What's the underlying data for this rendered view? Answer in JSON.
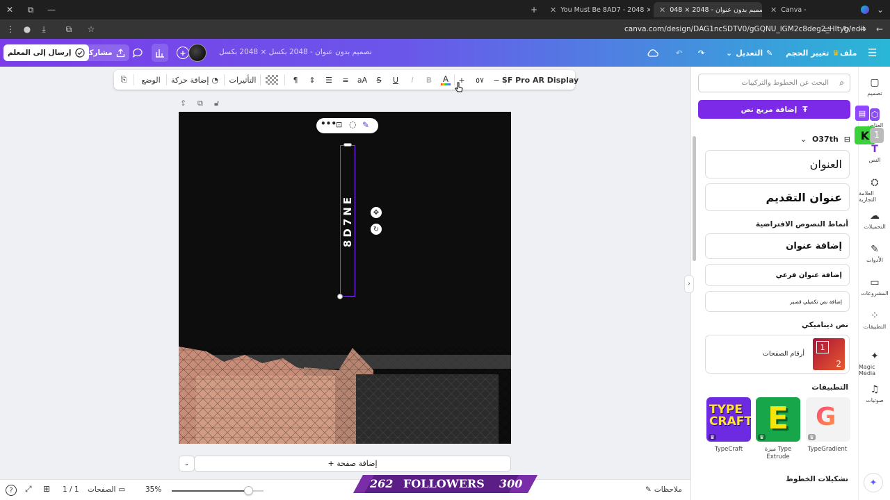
{
  "browser": {
    "tabs": [
      {
        "title": "You Must Be 8AD7 - 2048 × 20",
        "active": false
      },
      {
        "title": "تصميم بدون عنوان - 2048 × 048",
        "active": true
      },
      {
        "title": "Canva -",
        "active": false
      }
    ],
    "url": "canva.com/design/DAG1ncSDTV0/gGQNU_lGM2c8deg2_HItyg/edit"
  },
  "header": {
    "send_to_teacher": "إرسال إلى المعلم",
    "share": "مشاركة",
    "doc_title": "تصميم بدون عنوان - 2048 بكسل × 2048 بكسل",
    "edit_menu": "التعديل",
    "resize": "تغيير الحجم",
    "file": "ملف"
  },
  "toolbar": {
    "position": "الوضع",
    "add_animation": "إضافة حركة",
    "effects": "التأثيرات",
    "font_size": "٥٧",
    "font_name": "SF Pro AR Display",
    "minus": "−",
    "plus": "+"
  },
  "canvas": {
    "vertical_text": "8D7NE"
  },
  "add_page": "+ إضافة صفحة",
  "status": {
    "notes": "ملاحظات",
    "zoom": "35%",
    "zoom_fraction": 0.35,
    "pages_label": "الصفحات",
    "page_counter": "1 / 1"
  },
  "banner": {
    "left_num": "262",
    "text": "FOLLOWERS",
    "right_num": "300"
  },
  "panel": {
    "search_placeholder": "البحث عن الخطوط والتركيبات",
    "add_textbox": "إضافة مربع نص",
    "brand_font": "O37th",
    "heading_sample": "العنوان",
    "intro_sample": "عنوان التقديم",
    "default_styles_title": "أنماط النصوص الافتراضية",
    "add_heading": "إضافة عنوان",
    "add_subheading": "إضافة عنوان فرعي",
    "add_body": "إضافة نص تكميلي قصير",
    "dynamic_title": "نص ديناميكي",
    "page_numbers": "أرقام الصفحات",
    "apps_title": "التطبيقات",
    "apps": [
      {
        "name": "TypeCraft"
      },
      {
        "name": "ميزة Type Extrude"
      },
      {
        "name": "TypeGradient"
      }
    ],
    "font_combos_title": "تشكيلات الخطوط"
  },
  "rail": [
    {
      "label": "تصميم",
      "icon": "design-icon"
    },
    {
      "label": "العناصر",
      "icon": "elements-icon"
    },
    {
      "label": "النص",
      "icon": "text-icon"
    },
    {
      "label": "العلامة التجارية",
      "icon": "brand-icon"
    },
    {
      "label": "التحميلات",
      "icon": "uploads-icon"
    },
    {
      "label": "الأدوات",
      "icon": "tools-icon"
    },
    {
      "label": "المشروعات",
      "icon": "folder-icon"
    },
    {
      "label": "التطبيقات",
      "icon": "apps-icon"
    },
    {
      "label": "Magic Media",
      "icon": "magic-media-icon"
    },
    {
      "label": "صوتيات",
      "icon": "audio-icon"
    }
  ]
}
